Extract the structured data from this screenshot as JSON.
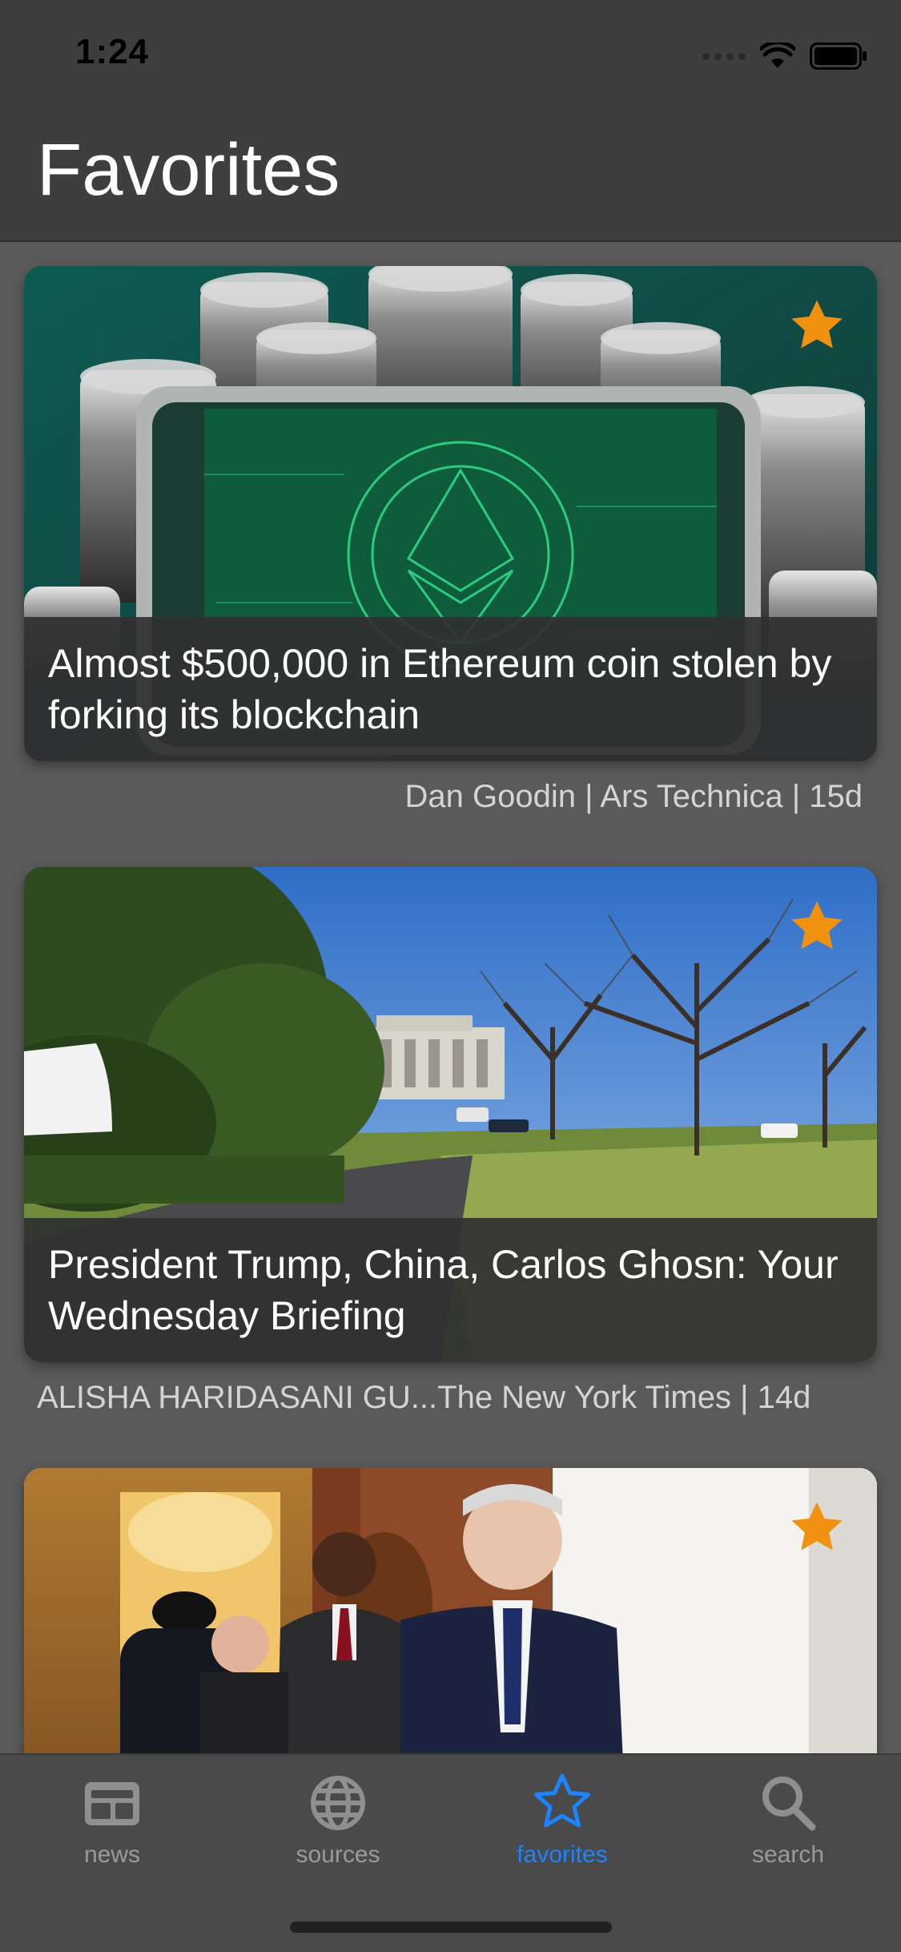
{
  "status_bar": {
    "time": "1:24"
  },
  "header": {
    "title": "Favorites"
  },
  "articles": [
    {
      "headline": "Almost $500,000 in Ethereum coin stolen by forking its blockchain",
      "byline": "Dan Goodin | Ars Technica | 15d",
      "favorited": true,
      "image": "ethereum-coins"
    },
    {
      "headline": "President Trump, China, Carlos Ghosn: Your Wednesday Briefing",
      "byline": "ALISHA HARIDASANI GU...The New York Times | 14d",
      "favorited": true,
      "image": "white-house-lawn"
    },
    {
      "headline": "",
      "byline": "",
      "favorited": true,
      "image": "officials-in-doorway"
    }
  ],
  "tabs": [
    {
      "label": "news",
      "icon": "newspaper-icon",
      "active": false
    },
    {
      "label": "sources",
      "icon": "globe-icon",
      "active": false
    },
    {
      "label": "favorites",
      "icon": "star-icon",
      "active": true
    },
    {
      "label": "search",
      "icon": "magnifier-icon",
      "active": false
    }
  ],
  "colors": {
    "accent": "#1b84ff",
    "star": "#f0920f",
    "background": "#5a5a5a",
    "bar": "#3e3e3e"
  }
}
